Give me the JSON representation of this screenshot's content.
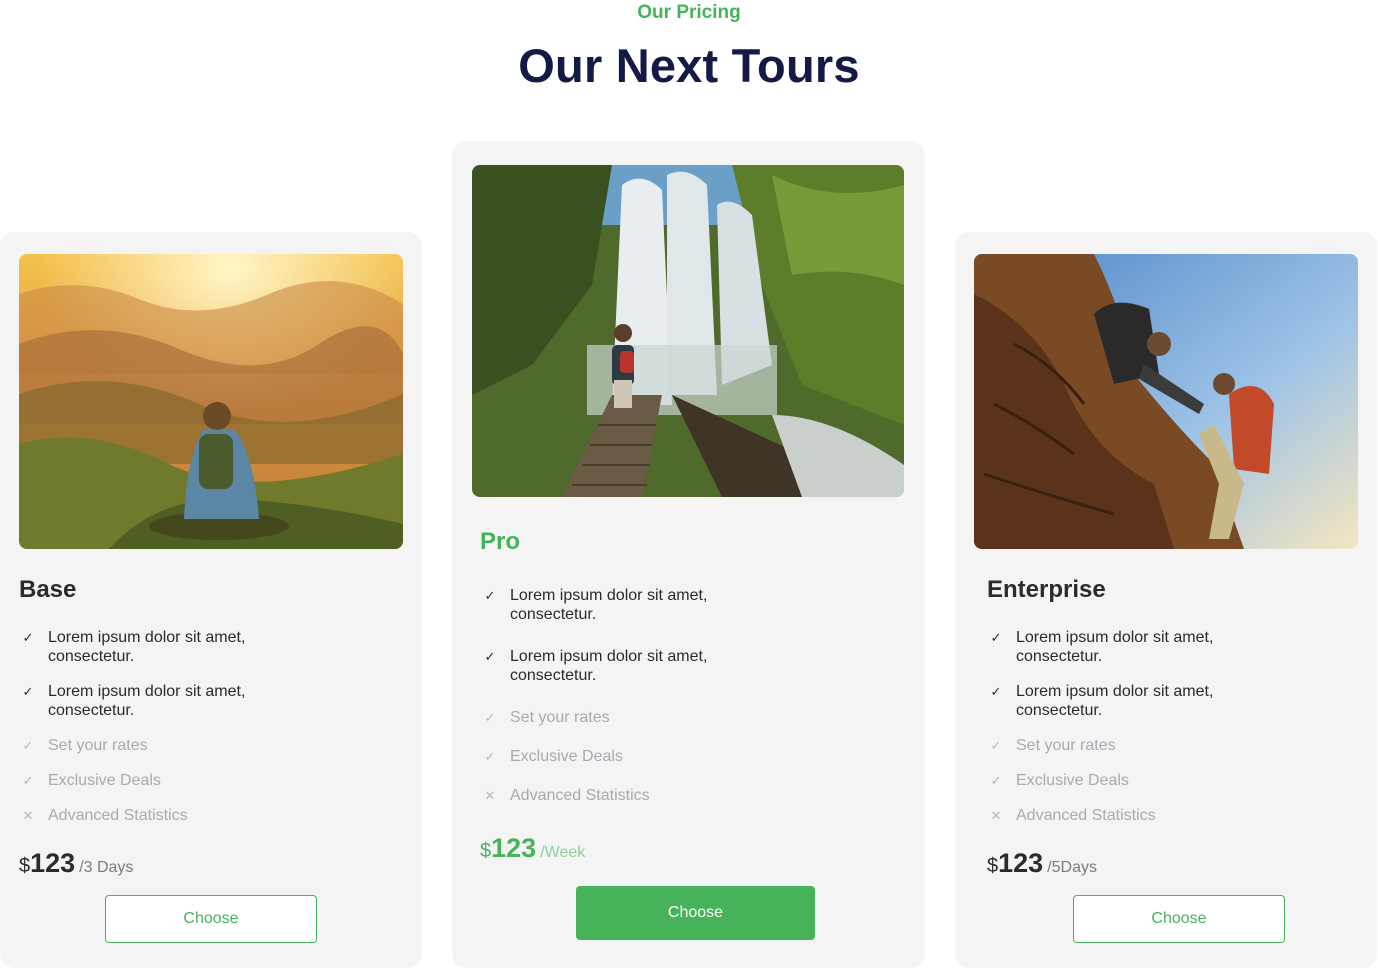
{
  "header": {
    "eyebrow": "Our Pricing",
    "title": "Our Next Tours"
  },
  "colors": {
    "accent": "#46b35a",
    "heading": "#131a46",
    "card_bg": "#f4f4f4"
  },
  "plans": {
    "base": {
      "name": "Base",
      "image_subject": "hiker-sitting-on-mountain-at-sunset",
      "features": [
        {
          "text": "Lorem ipsum dolor sit amet, consectetur.",
          "icon": "check-icon",
          "mark": "✓",
          "enabled": true
        },
        {
          "text": "Lorem ipsum dolor sit amet, consectetur.",
          "icon": "check-icon",
          "mark": "✓",
          "enabled": true
        },
        {
          "text": "Set your rates",
          "icon": "check-icon",
          "mark": "✓",
          "enabled": false
        },
        {
          "text": "Exclusive Deals",
          "icon": "check-icon",
          "mark": "✓",
          "enabled": false
        },
        {
          "text": "Advanced Statistics",
          "icon": "cross-icon",
          "mark": "✕",
          "enabled": false
        }
      ],
      "currency": "$",
      "price": "123",
      "period": "/3 Days",
      "button_label": "Choose"
    },
    "pro": {
      "name": "Pro",
      "image_subject": "hiker-at-waterfall",
      "features": [
        {
          "text": "Lorem ipsum dolor sit amet, consectetur.",
          "icon": "check-icon",
          "mark": "✓",
          "enabled": true
        },
        {
          "text": "Lorem ipsum dolor sit amet, consectetur.",
          "icon": "check-icon",
          "mark": "✓",
          "enabled": true
        },
        {
          "text": "Set your rates",
          "icon": "check-icon",
          "mark": "✓",
          "enabled": false
        },
        {
          "text": "Exclusive Deals",
          "icon": "check-icon",
          "mark": "✓",
          "enabled": false
        },
        {
          "text": "Advanced Statistics",
          "icon": "cross-icon",
          "mark": "✕",
          "enabled": false
        }
      ],
      "currency": "$",
      "price": "123",
      "period": "/Week",
      "button_label": "Choose"
    },
    "enterprise": {
      "name": "Enterprise",
      "image_subject": "climbers-helping-on-rock",
      "features": [
        {
          "text": "Lorem ipsum dolor sit amet, consectetur.",
          "icon": "check-icon",
          "mark": "✓",
          "enabled": true
        },
        {
          "text": "Lorem ipsum dolor sit amet, consectetur.",
          "icon": "check-icon",
          "mark": "✓",
          "enabled": true
        },
        {
          "text": "Set your rates",
          "icon": "check-icon",
          "mark": "✓",
          "enabled": false
        },
        {
          "text": "Exclusive Deals",
          "icon": "check-icon",
          "mark": "✓",
          "enabled": false
        },
        {
          "text": "Advanced Statistics",
          "icon": "cross-icon",
          "mark": "✕",
          "enabled": false
        }
      ],
      "currency": "$",
      "price": "123",
      "period": "/5Days",
      "button_label": "Choose"
    }
  }
}
